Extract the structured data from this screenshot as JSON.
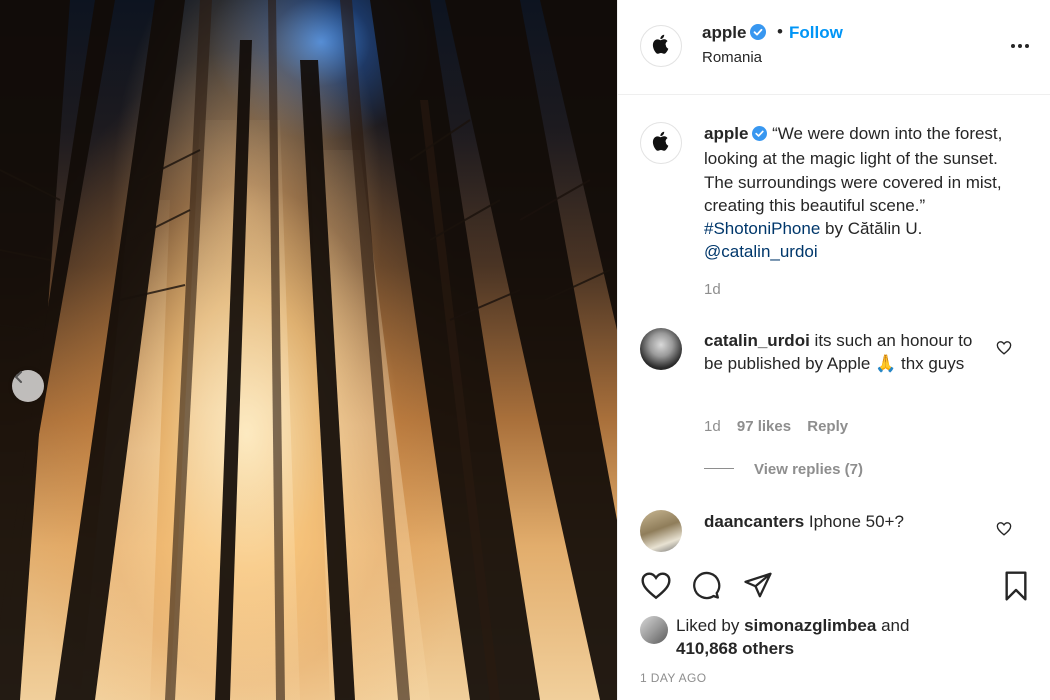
{
  "post": {
    "username": "apple",
    "follow_label": "Follow",
    "dot": "•",
    "location": "Romania"
  },
  "caption": {
    "username": "apple",
    "text": "“We were down into the forest, looking at the magic light of the sunset. The surroundings were covered in mist, creating this beautiful scene.”",
    "hashtag": "#ShotoniPhone",
    "by": "by Cătălin U.",
    "mention": "@catalin_urdoi",
    "time": "1d"
  },
  "comments": [
    {
      "username": "catalin_urdoi",
      "text": "its such an honour to be published by Apple 🙏 thx guys",
      "time": "1d",
      "likes": "97 likes",
      "reply_label": "Reply",
      "view_replies": "View replies (7)"
    },
    {
      "username": "daancanters",
      "text": "Iphone 50+?"
    }
  ],
  "likes": {
    "prefix": "Liked by",
    "user": "simonazglimbea",
    "and": "and",
    "others": "410,868 others"
  },
  "date": "1 DAY AGO",
  "icons": {
    "apple": "apple-logo-icon",
    "verified": "verified-badge-icon",
    "more": "more-options-icon",
    "like": "heart-icon",
    "comment": "comment-bubble-icon",
    "share": "paper-plane-icon",
    "save": "bookmark-icon",
    "prev": "chevron-left-icon"
  },
  "colors": {
    "accent": "#0095f6",
    "verified": "#3897f0",
    "link": "#00376b",
    "muted": "#8e8e8e"
  }
}
